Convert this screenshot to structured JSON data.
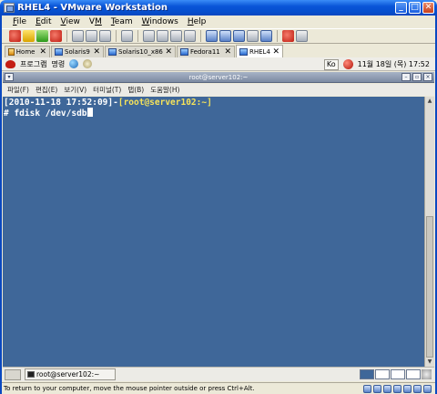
{
  "window": {
    "title": "RHEL4 - VMware Workstation",
    "controls": [
      "_",
      "□",
      "✕"
    ]
  },
  "menubar": [
    {
      "label": "File",
      "accel": "F"
    },
    {
      "label": "Edit",
      "accel": "E"
    },
    {
      "label": "View",
      "accel": "V"
    },
    {
      "label": "VM",
      "accel": "M"
    },
    {
      "label": "Team",
      "accel": "T"
    },
    {
      "label": "Windows",
      "accel": "W"
    },
    {
      "label": "Help",
      "accel": "H"
    }
  ],
  "toolbar": {
    "icons": [
      "power-off-icon",
      "suspend-icon",
      "power-on-icon",
      "reset-icon",
      "snapshot-icon",
      "revert-icon",
      "snapshot-manager-icon",
      "team-icon",
      "clone-icon",
      "summary-icon",
      "console-icon",
      "fullscreen-icon",
      "quick-switch-icon",
      "thumbnail-icon",
      "network-icon",
      "settings-icon"
    ]
  },
  "vm_tabs": [
    {
      "label": "Home",
      "active": false
    },
    {
      "label": "Solaris9",
      "active": false
    },
    {
      "label": "Solaris10_x86",
      "active": false
    },
    {
      "label": "Fedora11",
      "active": false
    },
    {
      "label": "RHEL4",
      "active": true
    }
  ],
  "gnome_panel": {
    "programs": "프로그램",
    "actions": "명령",
    "lang": "Ko",
    "clock": "11월 18일 (목) 17:52"
  },
  "terminal": {
    "window_title": "root@server102:~",
    "menu": [
      "파일(F)",
      "편집(E)",
      "보기(V)",
      "터미널(T)",
      "탭(B)",
      "도움말(H)"
    ],
    "lines": [
      {
        "timestamp": "[2010-11-18 17:52:09]",
        "dash": "-",
        "userhost": "[root@server102:~]"
      },
      {
        "prompt": "# fdisk /dev/sdb"
      }
    ]
  },
  "bottom_panel": {
    "task": "root@server102:~"
  },
  "statusbar": {
    "text": "To return to your computer, move the mouse pointer outside or press Ctrl+Alt."
  }
}
